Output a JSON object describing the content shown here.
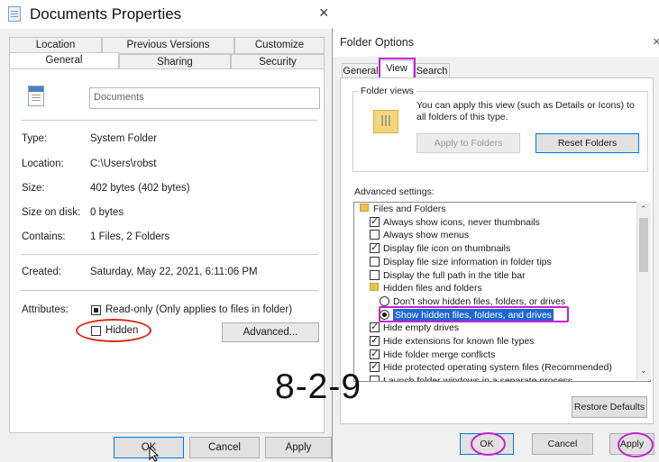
{
  "properties_dialog": {
    "title": "Documents Properties",
    "close_glyph": "×",
    "tabs_row1": [
      "Location",
      "Previous Versions",
      "Customize"
    ],
    "tabs_row2": [
      "General",
      "Sharing",
      "Security"
    ],
    "selected_tab": "General",
    "name_value": "Documents",
    "fields": [
      {
        "label": "Type:",
        "value": "System Folder"
      },
      {
        "label": "Location:",
        "value": "C:\\Users\\robst"
      },
      {
        "label": "Size:",
        "value": "402 bytes (402 bytes)"
      },
      {
        "label": "Size on disk:",
        "value": "0 bytes"
      },
      {
        "label": "Contains:",
        "value": "1 Files, 2 Folders"
      },
      {
        "label": "Created:",
        "value": "Saturday, May 22, 2021, 6:11:06 PM"
      }
    ],
    "attributes_label": "Attributes:",
    "readonly_label": "Read-only (Only applies to files in folder)",
    "hidden_label": "Hidden",
    "advanced_button": "Advanced...",
    "ok_button": "OK",
    "cancel_button": "Cancel",
    "apply_button": "Apply"
  },
  "folder_options": {
    "title": "Folder Options",
    "close_glyph": "×",
    "tabs": [
      "General",
      "View",
      "Search"
    ],
    "selected_tab": "View",
    "folder_views_label": "Folder views",
    "folder_views_text": "You can apply this view (such as Details or Icons) to all folders of this type.",
    "apply_to_folders_button": "Apply to Folders",
    "reset_folders_button": "Reset Folders",
    "advanced_settings_label": "Advanced settings:",
    "tree": [
      {
        "text": "Files and Folders",
        "kind": "folder",
        "indent": 0
      },
      {
        "text": "Always show icons, never thumbnails",
        "kind": "check",
        "checked": true,
        "indent": 1
      },
      {
        "text": "Always show menus",
        "kind": "check",
        "checked": false,
        "indent": 1
      },
      {
        "text": "Display file icon on thumbnails",
        "kind": "check",
        "checked": true,
        "indent": 1
      },
      {
        "text": "Display file size information in folder tips",
        "kind": "check",
        "checked": false,
        "indent": 1
      },
      {
        "text": "Display the full path in the title bar",
        "kind": "check",
        "checked": false,
        "indent": 1
      },
      {
        "text": "Hidden files and folders",
        "kind": "folder",
        "indent": 1
      },
      {
        "text": "Don't show hidden files, folders, or drives",
        "kind": "radio",
        "checked": false,
        "indent": 2
      },
      {
        "text": "Show hidden files, folders, and drives",
        "kind": "radio",
        "checked": true,
        "indent": 2,
        "selected": true
      },
      {
        "text": "Hide empty drives",
        "kind": "check",
        "checked": true,
        "indent": 1
      },
      {
        "text": "Hide extensions for known file types",
        "kind": "check",
        "checked": true,
        "indent": 1
      },
      {
        "text": "Hide folder merge conflicts",
        "kind": "check",
        "checked": true,
        "indent": 1
      },
      {
        "text": "Hide protected operating system files (Recommended)",
        "kind": "check",
        "checked": true,
        "indent": 1
      },
      {
        "text": "Launch folder windows in a separate process",
        "kind": "check",
        "checked": false,
        "indent": 1
      }
    ],
    "restore_defaults_button": "Restore Defaults",
    "ok_button": "OK",
    "cancel_button": "Cancel",
    "apply_button": "Apply"
  },
  "overlay_text": "8-2-9",
  "colors": {
    "annotation_red": "#d92b1f",
    "annotation_magenta": "#c81fd6",
    "selection_blue": "#1e66d8"
  }
}
